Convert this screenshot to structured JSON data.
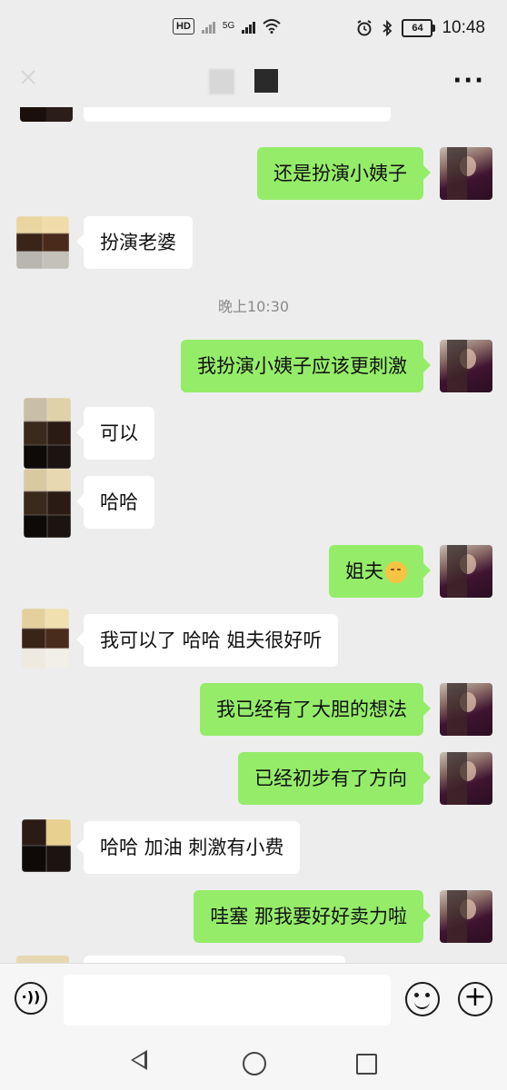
{
  "status_bar": {
    "hd_label": "HD",
    "network_label": "5G",
    "battery": "64",
    "time": "10:48"
  },
  "nav": {
    "back_icon": "back-arrow-icon",
    "more_icon": "more-dots-icon",
    "more_label": "···"
  },
  "chat": {
    "timestamp": "晚上10:30",
    "messages": [
      {
        "side": "left",
        "text": "扮演老婆"
      },
      {
        "side": "right",
        "text": "还是扮演小姨子"
      },
      {
        "side": "right",
        "text": "我扮演小姨子应该更刺激"
      },
      {
        "side": "left",
        "text": "可以"
      },
      {
        "side": "left",
        "text": "哈哈"
      },
      {
        "side": "right",
        "text": "姐夫"
      },
      {
        "side": "left",
        "text": "我可以了 哈哈 姐夫很好听"
      },
      {
        "side": "right",
        "text": "我已经有了大胆的想法"
      },
      {
        "side": "right",
        "text": "已经初步有了方向"
      },
      {
        "side": "left",
        "text": "哈哈 加油 刺激有小费"
      },
      {
        "side": "right",
        "text": "哇塞 那我要好好卖力啦"
      }
    ]
  },
  "input_bar": {
    "voice_icon": "voice-icon",
    "voice_label": "·))",
    "placeholder": "",
    "emoji_icon": "emoji-icon",
    "plus_icon": "plus-icon",
    "plus_label": "+"
  },
  "colors": {
    "background": "#ededed",
    "sent_bubble": "#95ec69",
    "received_bubble": "#ffffff"
  }
}
